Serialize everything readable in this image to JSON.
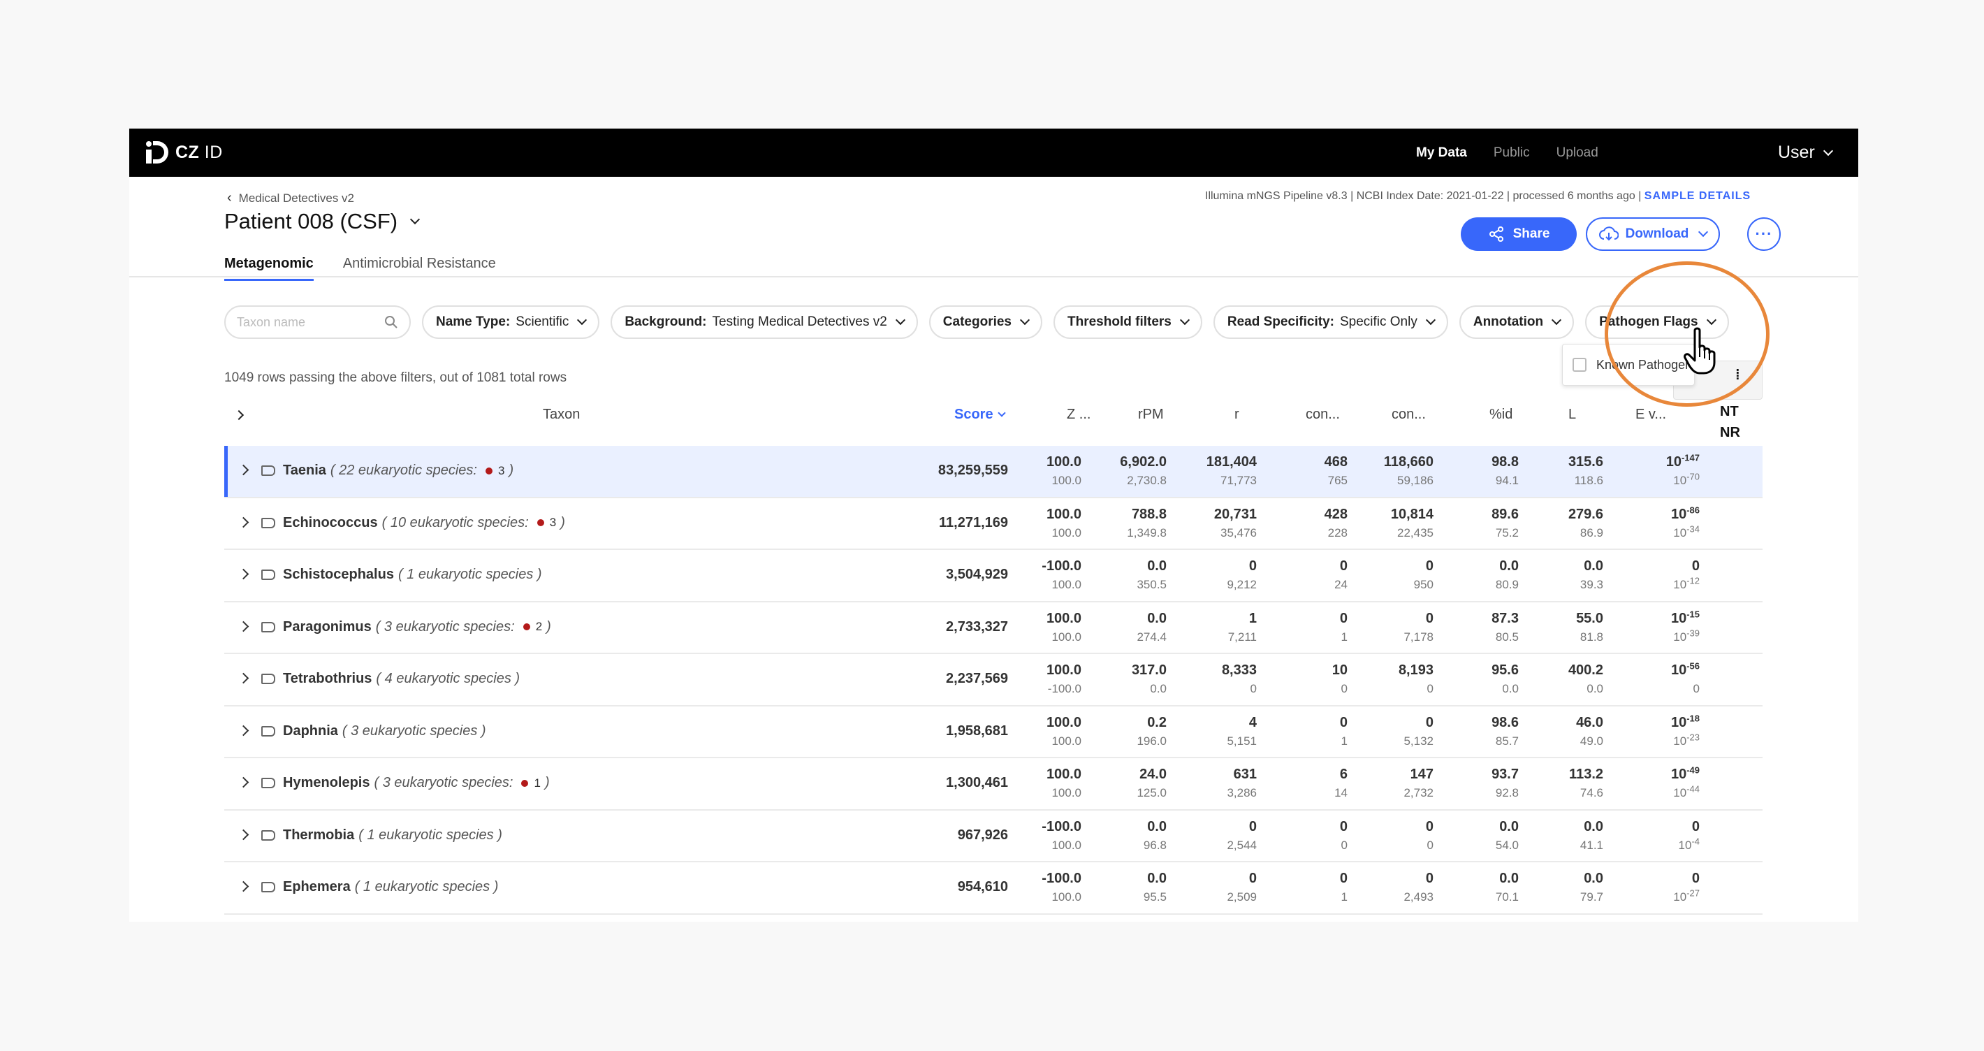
{
  "app": {
    "logo_text_bold": "CZ",
    "logo_text": "ID",
    "nav": [
      "My Data",
      "Public",
      "Upload"
    ],
    "user": "User"
  },
  "header": {
    "breadcrumb": "Medical Detectives v2",
    "title": "Patient 008 (CSF)",
    "pipeline_info": "Illumina mNGS Pipeline v8.3 | NCBI Index Date: 2021-01-22 | processed 6 months ago |",
    "sample_details": "SAMPLE DETAILS",
    "share": "Share",
    "download": "Download"
  },
  "tabs": [
    "Metagenomic",
    "Antimicrobial Resistance"
  ],
  "filters": {
    "search_placeholder": "Taxon name",
    "name_type_label": "Name Type:",
    "name_type_value": "Scientific",
    "background_label": "Background:",
    "background_value": "Testing Medical Detectives v2",
    "categories": "Categories",
    "threshold": "Threshold filters",
    "read_spec_label": "Read Specificity:",
    "read_spec_value": "Specific Only",
    "annotation": "Annotation",
    "pathogen_flags": "Pathogen Flags",
    "dropdown_option": "Known Pathogen"
  },
  "row_count": "1049 rows passing the above filters, out of 1081 total rows",
  "table": {
    "columns": [
      "Taxon",
      "Score",
      "Z ...",
      "rPM",
      "r",
      "con...",
      "con...",
      "%id",
      "L",
      "E v..."
    ],
    "nt_label": "NT",
    "nr_label": "NR",
    "rows": [
      {
        "name": "Taenia",
        "meta": "( 22 eukaryotic species:",
        "pcount": "3",
        "close": ")",
        "score": "83,259,559",
        "z": [
          "100.0",
          "100.0"
        ],
        "rpm": [
          "6,902.0",
          "2,730.8"
        ],
        "r": [
          "181,404",
          "71,773"
        ],
        "c1": [
          "468",
          "765"
        ],
        "c2": [
          "118,660",
          "59,186"
        ],
        "pid": [
          "98.8",
          "94.1"
        ],
        "l": [
          "315.6",
          "118.6"
        ],
        "e": [
          "-147",
          "-70"
        ],
        "ebase": [
          "10",
          "10"
        ]
      },
      {
        "name": "Echinococcus",
        "meta": "( 10 eukaryotic species:",
        "pcount": "3",
        "close": ")",
        "score": "11,271,169",
        "z": [
          "100.0",
          "100.0"
        ],
        "rpm": [
          "788.8",
          "1,349.8"
        ],
        "r": [
          "20,731",
          "35,476"
        ],
        "c1": [
          "428",
          "228"
        ],
        "c2": [
          "10,814",
          "22,435"
        ],
        "pid": [
          "89.6",
          "75.2"
        ],
        "l": [
          "279.6",
          "86.9"
        ],
        "e": [
          "-86",
          "-34"
        ],
        "ebase": [
          "10",
          "10"
        ]
      },
      {
        "name": "Schistocephalus",
        "meta": "( 1 eukaryotic species )",
        "pcount": "",
        "close": "",
        "score": "3,504,929",
        "z": [
          "-100.0",
          "100.0"
        ],
        "rpm": [
          "0.0",
          "350.5"
        ],
        "r": [
          "0",
          "9,212"
        ],
        "c1": [
          "0",
          "24"
        ],
        "c2": [
          "0",
          "950"
        ],
        "pid": [
          "0.0",
          "80.9"
        ],
        "l": [
          "0.0",
          "39.3"
        ],
        "e": [
          "",
          "-12"
        ],
        "ebase": [
          "0",
          "10"
        ]
      },
      {
        "name": "Paragonimus",
        "meta": "( 3 eukaryotic species:",
        "pcount": "2",
        "close": ")",
        "score": "2,733,327",
        "z": [
          "100.0",
          "100.0"
        ],
        "rpm": [
          "0.0",
          "274.4"
        ],
        "r": [
          "1",
          "7,211"
        ],
        "c1": [
          "0",
          "1"
        ],
        "c2": [
          "0",
          "7,178"
        ],
        "pid": [
          "87.3",
          "80.5"
        ],
        "l": [
          "55.0",
          "81.8"
        ],
        "e": [
          "-15",
          "-39"
        ],
        "ebase": [
          "10",
          "10"
        ]
      },
      {
        "name": "Tetrabothrius",
        "meta": "( 4 eukaryotic species )",
        "pcount": "",
        "close": "",
        "score": "2,237,569",
        "z": [
          "100.0",
          "-100.0"
        ],
        "rpm": [
          "317.0",
          "0.0"
        ],
        "r": [
          "8,333",
          "0"
        ],
        "c1": [
          "10",
          "0"
        ],
        "c2": [
          "8,193",
          "0"
        ],
        "pid": [
          "95.6",
          "0.0"
        ],
        "l": [
          "400.2",
          "0.0"
        ],
        "e": [
          "-56",
          ""
        ],
        "ebase": [
          "10",
          "0"
        ]
      },
      {
        "name": "Daphnia",
        "meta": "( 3 eukaryotic species )",
        "pcount": "",
        "close": "",
        "score": "1,958,681",
        "z": [
          "100.0",
          "100.0"
        ],
        "rpm": [
          "0.2",
          "196.0"
        ],
        "r": [
          "4",
          "5,151"
        ],
        "c1": [
          "0",
          "1"
        ],
        "c2": [
          "0",
          "5,132"
        ],
        "pid": [
          "98.6",
          "85.7"
        ],
        "l": [
          "46.0",
          "49.0"
        ],
        "e": [
          "-18",
          "-23"
        ],
        "ebase": [
          "10",
          "10"
        ]
      },
      {
        "name": "Hymenolepis",
        "meta": "( 3 eukaryotic species:",
        "pcount": "1",
        "close": ")",
        "score": "1,300,461",
        "z": [
          "100.0",
          "100.0"
        ],
        "rpm": [
          "24.0",
          "125.0"
        ],
        "r": [
          "631",
          "3,286"
        ],
        "c1": [
          "6",
          "14"
        ],
        "c2": [
          "147",
          "2,732"
        ],
        "pid": [
          "93.7",
          "92.8"
        ],
        "l": [
          "113.2",
          "74.6"
        ],
        "e": [
          "-49",
          "-44"
        ],
        "ebase": [
          "10",
          "10"
        ]
      },
      {
        "name": "Thermobia",
        "meta": "( 1 eukaryotic species )",
        "pcount": "",
        "close": "",
        "score": "967,926",
        "z": [
          "-100.0",
          "100.0"
        ],
        "rpm": [
          "0.0",
          "96.8"
        ],
        "r": [
          "0",
          "2,544"
        ],
        "c1": [
          "0",
          "0"
        ],
        "c2": [
          "0",
          "0"
        ],
        "pid": [
          "0.0",
          "54.0"
        ],
        "l": [
          "0.0",
          "41.1"
        ],
        "e": [
          "",
          "-4"
        ],
        "ebase": [
          "0",
          "10"
        ]
      },
      {
        "name": "Ephemera",
        "meta": "( 1 eukaryotic species )",
        "pcount": "",
        "close": "",
        "score": "954,610",
        "z": [
          "-100.0",
          "100.0"
        ],
        "rpm": [
          "0.0",
          "95.5"
        ],
        "r": [
          "0",
          "2,509"
        ],
        "c1": [
          "0",
          "1"
        ],
        "c2": [
          "0",
          "2,493"
        ],
        "pid": [
          "0.0",
          "70.1"
        ],
        "l": [
          "0.0",
          "79.7"
        ],
        "e": [
          "",
          "-27"
        ],
        "ebase": [
          "0",
          "10"
        ]
      }
    ]
  },
  "colors": {
    "accent": "#3867fa",
    "highlight_ring": "#e8873a",
    "pathogen_dot": "#b31a1a",
    "selected_row": "#eaf0ff"
  }
}
